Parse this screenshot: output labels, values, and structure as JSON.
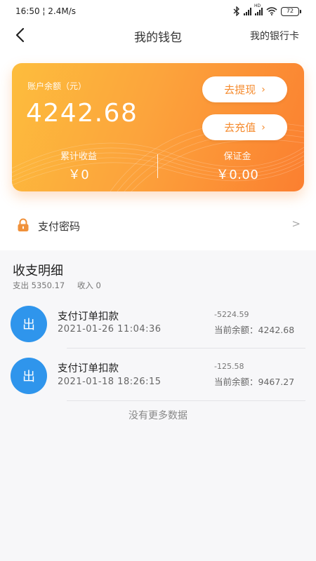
{
  "status_bar": {
    "time": "16:50",
    "network_speed": "2.4M/s",
    "network_type": "4G",
    "battery": "72",
    "icons": [
      "bluetooth-icon",
      "signal-icon",
      "hd-signal-icon",
      "wifi-icon",
      "battery-icon"
    ]
  },
  "nav": {
    "back_icon": "back-arrow-icon",
    "title": "我的钱包",
    "bank_card_label": "我的银行卡"
  },
  "wallet_card": {
    "balance_label": "账户余额（元）",
    "balance_value": "4242.68",
    "withdraw_label": "去提现",
    "recharge_label": "去充值",
    "chevron": "›",
    "earnings_label": "累计收益",
    "earnings_value": "￥0",
    "deposit_label": "保证金",
    "deposit_value": "￥0.00",
    "gradient_colors": [
      "#fdbd3d",
      "#fca43c",
      "#fb7f30"
    ],
    "button_text_color": "#f58b2e"
  },
  "payment_password": {
    "icon": "lock-icon",
    "label": "支付密码",
    "arrow": ">"
  },
  "transactions_section": {
    "title": "收支明细",
    "expense_summary": "支出 5350.17",
    "income_summary": "收入 0",
    "items": [
      {
        "icon_text": "出",
        "title": "支付订单扣款",
        "date": "2021-01-26 11:04:36",
        "amount": "-5224.59",
        "balance": "当前余额：4242.68"
      },
      {
        "icon_text": "出",
        "title": "支付订单扣款",
        "date": "2021-01-18 18:26:15",
        "amount": "-125.58",
        "balance": "当前余额：9467.27"
      }
    ],
    "no_more_text": "没有更多数据",
    "icon_color": "#2f95ec"
  }
}
